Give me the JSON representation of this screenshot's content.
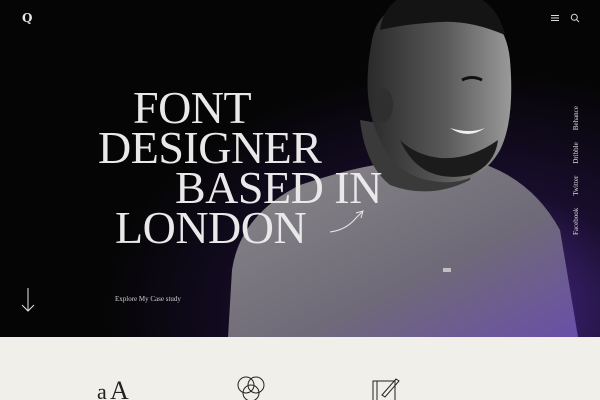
{
  "brand": {
    "logo": "Q"
  },
  "header": {
    "icons": [
      "menu-icon",
      "search-icon"
    ]
  },
  "hero": {
    "headline": [
      "FONT",
      "DESIGNER",
      "BASED IN",
      "LONDON"
    ],
    "cta_label": "Explore My Case study"
  },
  "social_links": [
    "Facebook",
    "Twitter",
    "Dribble",
    "Behance"
  ],
  "features": {
    "icons": [
      "typography-icon",
      "color-circles-icon",
      "sketch-pad-icon"
    ]
  },
  "colors": {
    "accent": "#6e3cd2",
    "hero_bg": "#050505",
    "section_bg": "#f1efe9",
    "text_light": "#e9e9e9"
  }
}
